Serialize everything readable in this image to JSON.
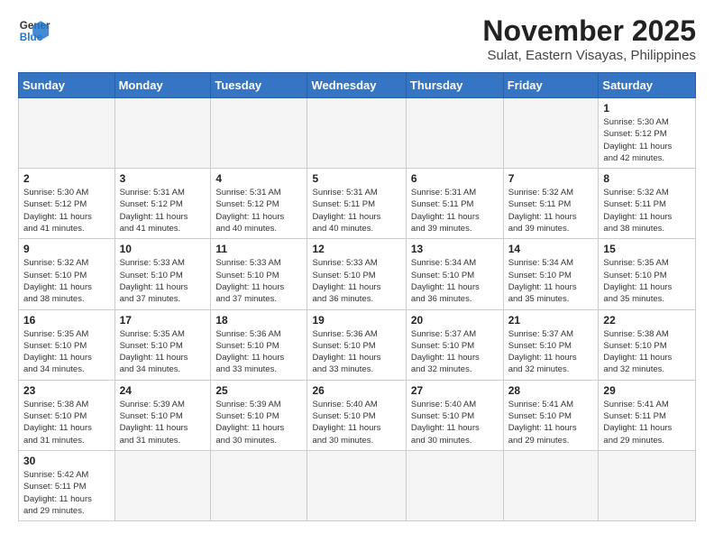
{
  "header": {
    "logo_general": "General",
    "logo_blue": "Blue",
    "month_title": "November 2025",
    "location": "Sulat, Eastern Visayas, Philippines"
  },
  "weekdays": [
    "Sunday",
    "Monday",
    "Tuesday",
    "Wednesday",
    "Thursday",
    "Friday",
    "Saturday"
  ],
  "weeks": [
    [
      {
        "day": "",
        "info": ""
      },
      {
        "day": "",
        "info": ""
      },
      {
        "day": "",
        "info": ""
      },
      {
        "day": "",
        "info": ""
      },
      {
        "day": "",
        "info": ""
      },
      {
        "day": "",
        "info": ""
      },
      {
        "day": "1",
        "info": "Sunrise: 5:30 AM\nSunset: 5:12 PM\nDaylight: 11 hours\nand 42 minutes."
      }
    ],
    [
      {
        "day": "2",
        "info": "Sunrise: 5:30 AM\nSunset: 5:12 PM\nDaylight: 11 hours\nand 41 minutes."
      },
      {
        "day": "3",
        "info": "Sunrise: 5:31 AM\nSunset: 5:12 PM\nDaylight: 11 hours\nand 41 minutes."
      },
      {
        "day": "4",
        "info": "Sunrise: 5:31 AM\nSunset: 5:12 PM\nDaylight: 11 hours\nand 40 minutes."
      },
      {
        "day": "5",
        "info": "Sunrise: 5:31 AM\nSunset: 5:11 PM\nDaylight: 11 hours\nand 40 minutes."
      },
      {
        "day": "6",
        "info": "Sunrise: 5:31 AM\nSunset: 5:11 PM\nDaylight: 11 hours\nand 39 minutes."
      },
      {
        "day": "7",
        "info": "Sunrise: 5:32 AM\nSunset: 5:11 PM\nDaylight: 11 hours\nand 39 minutes."
      },
      {
        "day": "8",
        "info": "Sunrise: 5:32 AM\nSunset: 5:11 PM\nDaylight: 11 hours\nand 38 minutes."
      }
    ],
    [
      {
        "day": "9",
        "info": "Sunrise: 5:32 AM\nSunset: 5:10 PM\nDaylight: 11 hours\nand 38 minutes."
      },
      {
        "day": "10",
        "info": "Sunrise: 5:33 AM\nSunset: 5:10 PM\nDaylight: 11 hours\nand 37 minutes."
      },
      {
        "day": "11",
        "info": "Sunrise: 5:33 AM\nSunset: 5:10 PM\nDaylight: 11 hours\nand 37 minutes."
      },
      {
        "day": "12",
        "info": "Sunrise: 5:33 AM\nSunset: 5:10 PM\nDaylight: 11 hours\nand 36 minutes."
      },
      {
        "day": "13",
        "info": "Sunrise: 5:34 AM\nSunset: 5:10 PM\nDaylight: 11 hours\nand 36 minutes."
      },
      {
        "day": "14",
        "info": "Sunrise: 5:34 AM\nSunset: 5:10 PM\nDaylight: 11 hours\nand 35 minutes."
      },
      {
        "day": "15",
        "info": "Sunrise: 5:35 AM\nSunset: 5:10 PM\nDaylight: 11 hours\nand 35 minutes."
      }
    ],
    [
      {
        "day": "16",
        "info": "Sunrise: 5:35 AM\nSunset: 5:10 PM\nDaylight: 11 hours\nand 34 minutes."
      },
      {
        "day": "17",
        "info": "Sunrise: 5:35 AM\nSunset: 5:10 PM\nDaylight: 11 hours\nand 34 minutes."
      },
      {
        "day": "18",
        "info": "Sunrise: 5:36 AM\nSunset: 5:10 PM\nDaylight: 11 hours\nand 33 minutes."
      },
      {
        "day": "19",
        "info": "Sunrise: 5:36 AM\nSunset: 5:10 PM\nDaylight: 11 hours\nand 33 minutes."
      },
      {
        "day": "20",
        "info": "Sunrise: 5:37 AM\nSunset: 5:10 PM\nDaylight: 11 hours\nand 32 minutes."
      },
      {
        "day": "21",
        "info": "Sunrise: 5:37 AM\nSunset: 5:10 PM\nDaylight: 11 hours\nand 32 minutes."
      },
      {
        "day": "22",
        "info": "Sunrise: 5:38 AM\nSunset: 5:10 PM\nDaylight: 11 hours\nand 32 minutes."
      }
    ],
    [
      {
        "day": "23",
        "info": "Sunrise: 5:38 AM\nSunset: 5:10 PM\nDaylight: 11 hours\nand 31 minutes."
      },
      {
        "day": "24",
        "info": "Sunrise: 5:39 AM\nSunset: 5:10 PM\nDaylight: 11 hours\nand 31 minutes."
      },
      {
        "day": "25",
        "info": "Sunrise: 5:39 AM\nSunset: 5:10 PM\nDaylight: 11 hours\nand 30 minutes."
      },
      {
        "day": "26",
        "info": "Sunrise: 5:40 AM\nSunset: 5:10 PM\nDaylight: 11 hours\nand 30 minutes."
      },
      {
        "day": "27",
        "info": "Sunrise: 5:40 AM\nSunset: 5:10 PM\nDaylight: 11 hours\nand 30 minutes."
      },
      {
        "day": "28",
        "info": "Sunrise: 5:41 AM\nSunset: 5:10 PM\nDaylight: 11 hours\nand 29 minutes."
      },
      {
        "day": "29",
        "info": "Sunrise: 5:41 AM\nSunset: 5:11 PM\nDaylight: 11 hours\nand 29 minutes."
      }
    ],
    [
      {
        "day": "30",
        "info": "Sunrise: 5:42 AM\nSunset: 5:11 PM\nDaylight: 11 hours\nand 29 minutes."
      },
      {
        "day": "",
        "info": ""
      },
      {
        "day": "",
        "info": ""
      },
      {
        "day": "",
        "info": ""
      },
      {
        "day": "",
        "info": ""
      },
      {
        "day": "",
        "info": ""
      },
      {
        "day": "",
        "info": ""
      }
    ]
  ]
}
